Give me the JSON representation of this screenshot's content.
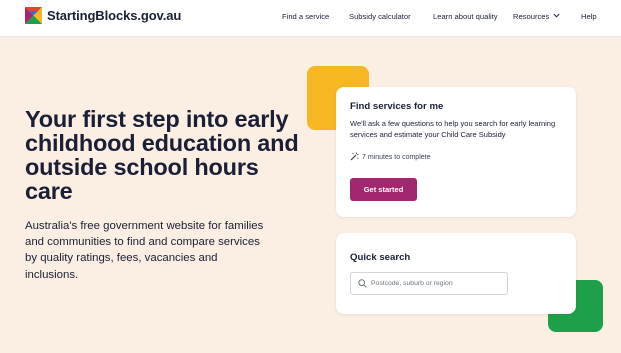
{
  "header": {
    "brand": "StartingBlocks.gov.au",
    "nav": {
      "find_service": "Find a service",
      "subsidy_calculator": "Subsidy calculator",
      "learn_quality": "Learn about quality",
      "resources": "Resources",
      "help": "Help"
    },
    "logo_colors": [
      "#e8412c",
      "#f6b722",
      "#1ea04a",
      "#a3276f",
      "#2a6fdb"
    ]
  },
  "hero": {
    "headline": "Your first step into early childhood education and outside school hours care",
    "subtext": "Australia's free government website for families and communities to find and compare services by quality ratings, fees, vacancies and inclusions."
  },
  "find_card": {
    "title": "Find services for me",
    "description": "We'll ask a few questions to help you search for early learning services and estimate your Child Care Subsidy",
    "time": "7 minutes to complete",
    "button": "Get started"
  },
  "quick_search": {
    "title": "Quick search",
    "placeholder": "Postcode, suburb or region"
  },
  "colors": {
    "background": "#fbeee3",
    "accent_button": "#a3276f",
    "deco_yellow": "#f6b722",
    "deco_green": "#1ea04a",
    "text": "#1a1f36"
  },
  "icons": {
    "time": "magic-wand-icon",
    "search": "search-icon",
    "resources_dropdown": "chevron-down-icon"
  }
}
